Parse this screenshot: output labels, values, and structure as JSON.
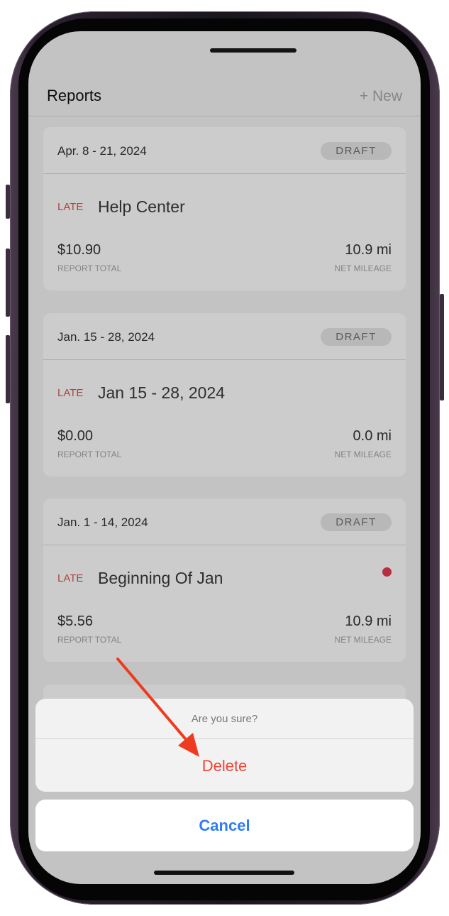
{
  "navbar": {
    "title": "Reports",
    "new_label": "+ New"
  },
  "reports": [
    {
      "date_range": "Apr. 8 - 21, 2024",
      "status": "DRAFT",
      "late": "LATE",
      "name": "Help Center",
      "total": "$10.90",
      "total_label": "REPORT TOTAL",
      "mileage": "10.9 mi",
      "mileage_label": "NET MILEAGE",
      "unread": false
    },
    {
      "date_range": "Jan. 15 - 28, 2024",
      "status": "DRAFT",
      "late": "LATE",
      "name": "Jan 15 - 28, 2024",
      "total": "$0.00",
      "total_label": "REPORT TOTAL",
      "mileage": "0.0 mi",
      "mileage_label": "NET MILEAGE",
      "unread": false
    },
    {
      "date_range": "Jan. 1 - 14, 2024",
      "status": "DRAFT",
      "late": "LATE",
      "name": "Beginning Of Jan",
      "total": "$5.56",
      "total_label": "REPORT TOTAL",
      "mileage": "10.9 mi",
      "mileage_label": "NET MILEAGE",
      "unread": true
    }
  ],
  "action_sheet": {
    "title": "Are you sure?",
    "delete_label": "Delete",
    "cancel_label": "Cancel"
  },
  "colors": {
    "late": "#d7574e",
    "delete": "#ef4438",
    "cancel": "#2f7cf6",
    "unread_dot": "#e9384f",
    "annotation_arrow": "#ee3b1f"
  }
}
